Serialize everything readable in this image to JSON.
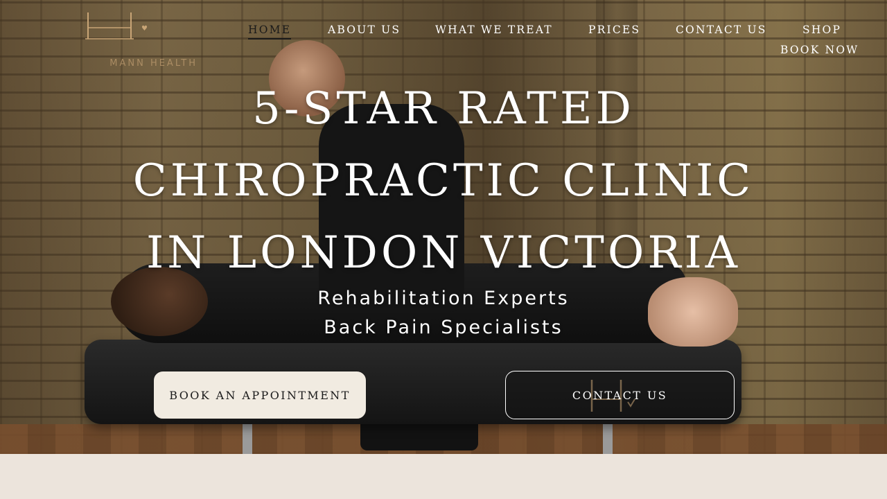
{
  "brand": {
    "logo_text": "MANN HEALTH",
    "accent_color": "#c9a576"
  },
  "nav": {
    "items": [
      {
        "label": "HOME",
        "active": true
      },
      {
        "label": "ABOUT US"
      },
      {
        "label": "WHAT WE TREAT"
      },
      {
        "label": "PRICES"
      },
      {
        "label": "CONTACT US"
      },
      {
        "label": "SHOP"
      },
      {
        "label": "BOOK NOW"
      }
    ]
  },
  "hero": {
    "headline_lines": [
      "5-STAR RATED",
      "CHIROPRACTIC CLINIC",
      "IN LONDON VICTORIA"
    ],
    "subhead_lines": [
      "Rehabilitation Experts",
      "Back Pain Specialists"
    ],
    "cta_primary": "BOOK AN APPOINTMENT",
    "cta_secondary": "CONTACT US"
  },
  "colors": {
    "cream": "#f1ebe1",
    "band": "#ece4dc",
    "text_dark": "#1a1a1a"
  }
}
